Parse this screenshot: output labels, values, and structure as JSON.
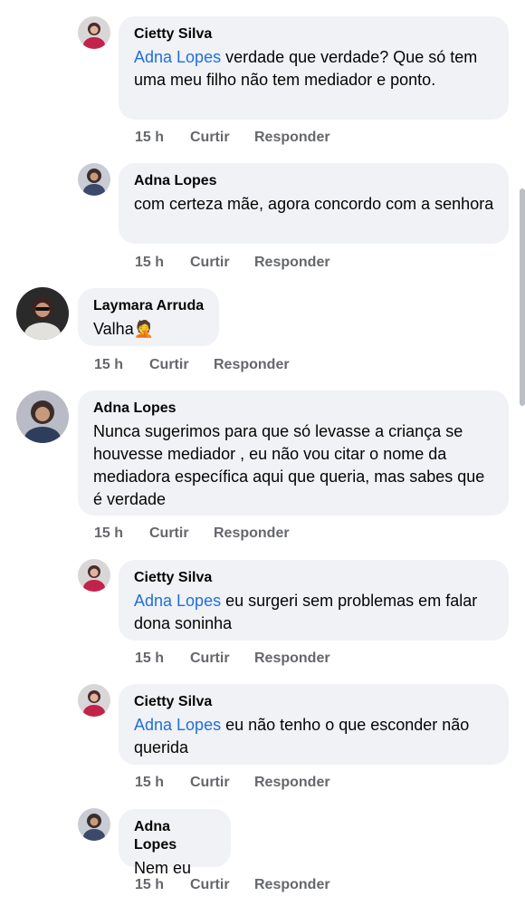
{
  "colors": {
    "mention": "#216fdb",
    "bubble": "#f0f2f5",
    "meta": "#65676b"
  },
  "comments": [
    {
      "author": "Cietty Silva",
      "mention": "Adna Lopes",
      "text": " verdade que verdade? Que só tem uma meu filho não tem mediador e ponto.",
      "time": "15 h",
      "like": "Curtir",
      "reply": "Responder"
    },
    {
      "author": "Adna Lopes",
      "mention": "",
      "text": "com certeza mãe, agora concordo com a senhora",
      "time": "15 h",
      "like": "Curtir",
      "reply": "Responder"
    },
    {
      "author": "Laymara Arruda",
      "mention": "",
      "text": "Valha",
      "emoji": "🤦",
      "time": "15 h",
      "like": "Curtir",
      "reply": "Responder"
    },
    {
      "author": "Adna Lopes",
      "mention": "",
      "text": "Nunca sugerimos para que só levasse a criança se houvesse mediador , eu não vou citar o nome da mediadora específica aqui que queria, mas sabes que é verdade",
      "time": "15 h",
      "like": "Curtir",
      "reply": "Responder"
    },
    {
      "author": "Cietty Silva",
      "mention": "Adna Lopes",
      "text": " eu surgeri sem problemas em falar dona soninha",
      "time": "15 h",
      "like": "Curtir",
      "reply": "Responder"
    },
    {
      "author": "Cietty Silva",
      "mention": "Adna Lopes",
      "text": " eu não tenho o que esconder não querida",
      "time": "15 h",
      "like": "Curtir",
      "reply": "Responder"
    },
    {
      "author": "Adna Lopes",
      "mention": "",
      "text": "Nem eu",
      "time": "15 h",
      "like": "Curtir",
      "reply": "Responder"
    }
  ]
}
